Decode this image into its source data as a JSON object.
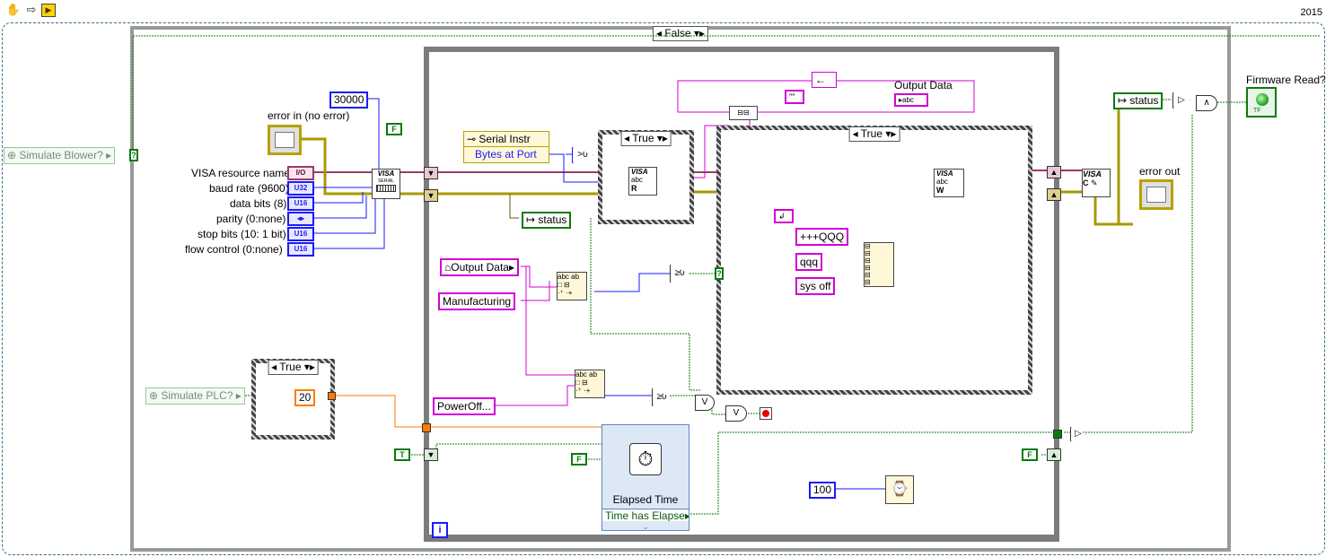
{
  "toolbar": {
    "year": "2015",
    "icons": [
      "hand-tool-icon",
      "run-arrow-icon",
      "labview-icon"
    ]
  },
  "case_outer": {
    "selector": "False"
  },
  "controls": {
    "simulate_blower": "Simulate Blower?",
    "simulate_plc": "Simulate PLC?",
    "error_in": "error in (no error)",
    "error_out": "error out",
    "firmware_read": "Firmware Read?",
    "visa_resource_name": "VISA resource name",
    "baud_rate": "baud rate (9600)",
    "data_bits": "data bits (8)",
    "parity": "parity (0:none)",
    "stop_bits": "stop bits (10: 1 bit)",
    "flow_control": "flow control (0:none)",
    "const_30000": "30000",
    "const_20": "20",
    "const_100": "100",
    "output_data_local": "Output Data",
    "output_data_indicator": "Output Data",
    "manufacturing": "Manufacturing",
    "poweroff": "PowerOff...",
    "status_unbundle": "status",
    "status_right": "status",
    "property_node_class": "Serial Instr",
    "property_node_prop": "Bytes at Port",
    "qqq_plus": "+++QQQ",
    "qqq": "qqq",
    "sys_off": "sys off",
    "empty_string": "\"\"",
    "bool_true": "T",
    "bool_false": "F"
  },
  "type_terms": {
    "io": "I/O",
    "u32": "U32",
    "u16": "U16",
    "enum": "◂▸"
  },
  "inner_cases": {
    "read_case": "True",
    "write_case": "True",
    "plc_case": "True"
  },
  "express_vi": {
    "title": "Elapsed Time",
    "output": "Time has Elapse"
  },
  "visa": {
    "serial": "VISA",
    "abc": "abc",
    "r": "R",
    "w": "W"
  },
  "info_label": "i"
}
